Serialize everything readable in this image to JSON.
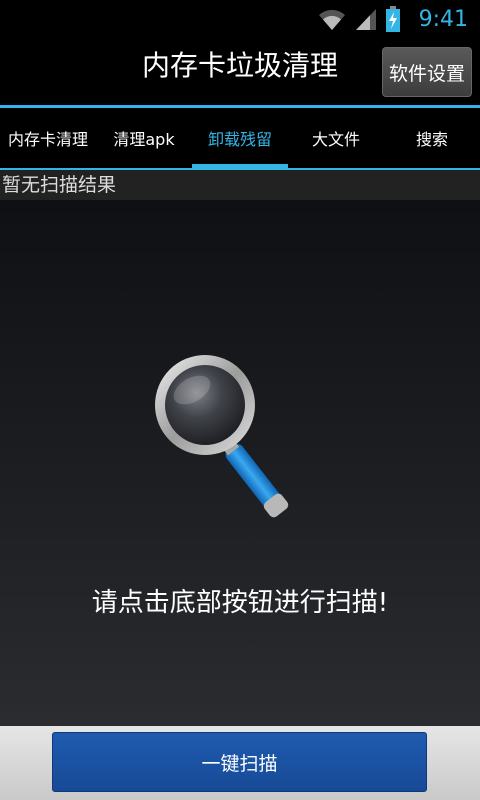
{
  "status_bar": {
    "time": "9:41",
    "icons": [
      "wifi-icon",
      "signal-icon",
      "battery-charging-icon"
    ],
    "accent_color": "#33b5e5"
  },
  "header": {
    "title": "内存卡垃圾清理",
    "settings_label": "软件设置"
  },
  "tabs": [
    {
      "label": "内存卡清理",
      "active": false
    },
    {
      "label": "清理apk",
      "active": false
    },
    {
      "label": "卸载残留",
      "active": true
    },
    {
      "label": "大文件",
      "active": false
    },
    {
      "label": "搜索",
      "active": false
    }
  ],
  "results": {
    "empty_label": "暂无扫描结果"
  },
  "main": {
    "illustration_icon": "magnifier-icon",
    "hint": "请点击底部按钮进行扫描!"
  },
  "footer": {
    "scan_label": "一键扫描",
    "button_color": "#1a519f"
  }
}
